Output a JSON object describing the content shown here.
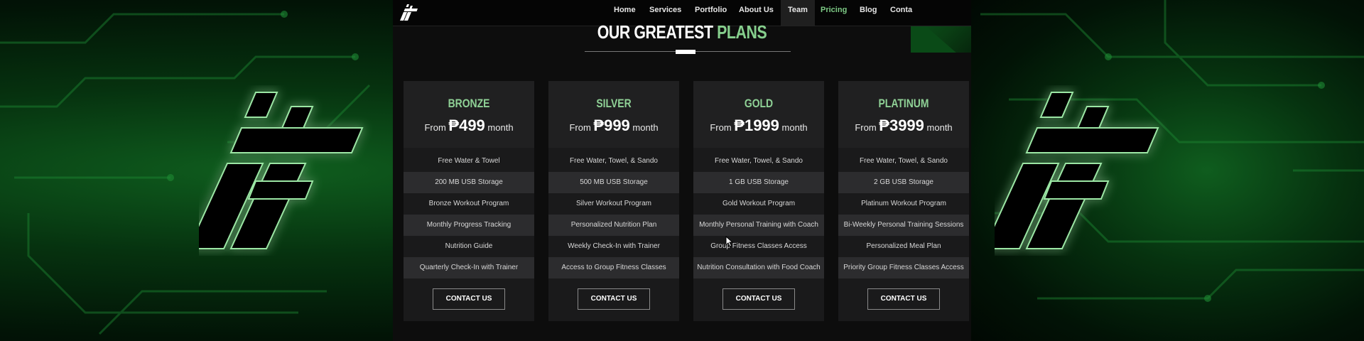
{
  "nav": {
    "logo_text": "FF",
    "links": [
      {
        "label": "Home"
      },
      {
        "label": "Services"
      },
      {
        "label": "Portfolio"
      },
      {
        "label": "About Us"
      },
      {
        "label": "Team"
      },
      {
        "label": "Pricing"
      },
      {
        "label": "Blog"
      },
      {
        "label": "Conta"
      }
    ],
    "active_label": "Team",
    "highlight_label": "Pricing"
  },
  "section": {
    "heading_part1": "OUR GREATEST",
    "heading_part2": "PLANS"
  },
  "plans": [
    {
      "name": "BRONZE",
      "price_prefix": "From",
      "price": "₱499",
      "price_suffix": "month",
      "features": [
        "Free Water & Towel",
        "200 MB USB Storage",
        "Bronze Workout Program",
        "Monthly Progress Tracking",
        "Nutrition Guide",
        "Quarterly Check-In with Trainer"
      ],
      "button": "CONTACT US"
    },
    {
      "name": "SILVER",
      "price_prefix": "From",
      "price": "₱999",
      "price_suffix": "month",
      "features": [
        "Free Water, Towel, & Sando",
        "500 MB USB Storage",
        "Silver Workout Program",
        "Personalized Nutrition Plan",
        "Weekly Check-In with Trainer",
        "Access to Group Fitness Classes"
      ],
      "button": "CONTACT US"
    },
    {
      "name": "GOLD",
      "price_prefix": "From",
      "price": "₱1999",
      "price_suffix": "month",
      "features": [
        "Free Water, Towel, & Sando",
        "1 GB USB Storage",
        "Gold Workout Program",
        "Monthly Personal Training with Coach",
        "Group Fitness Classes Access",
        "Nutrition Consultation with Food Coach"
      ],
      "button": "CONTACT US"
    },
    {
      "name": "PLATINUM",
      "price_prefix": "From",
      "price": "₱3999",
      "price_suffix": "month",
      "features": [
        "Free Water, Towel, & Sando",
        "2 GB USB Storage",
        "Platinum Workout Program",
        "Bi-Weekly Personal Training Sessions",
        "Personalized Meal Plan",
        "Priority Group Fitness Classes Access"
      ],
      "button": "CONTACT US"
    }
  ],
  "colors": {
    "accent_green": "#86cf8d",
    "card_bg": "#1a1a1b",
    "alt_row": "#2c2c2e",
    "background_green": "#0f5d1e"
  },
  "icons": {
    "brand_logo": "ff-logo-icon",
    "pointer": "mouse-cursor-icon"
  }
}
